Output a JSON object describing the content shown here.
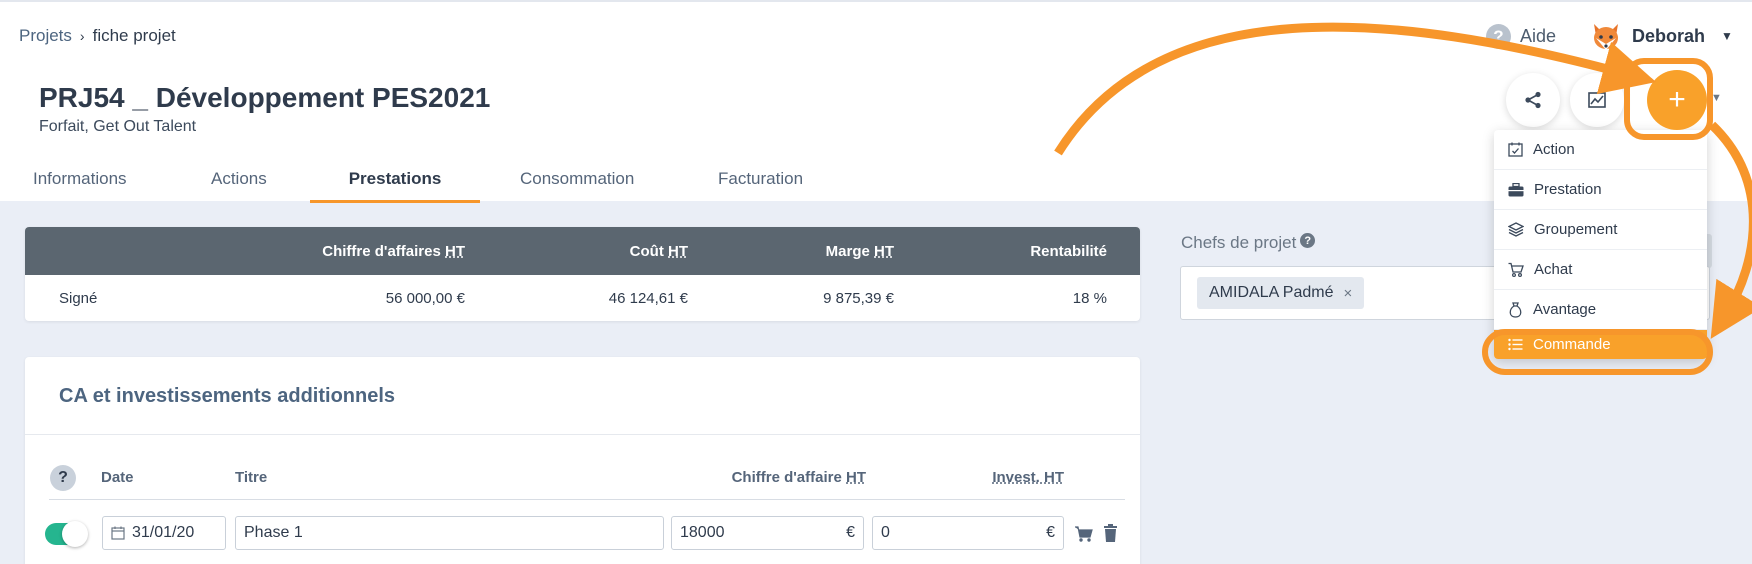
{
  "breadcrumb": {
    "parent": "Projets",
    "separator": "›",
    "current": "fiche projet"
  },
  "header": {
    "help_label": "Aide",
    "user_name": "Deborah",
    "project_title": "PRJ54 _ Développement PES2021",
    "project_subtitle": "Forfait, Get Out Talent"
  },
  "actions": {
    "plus_label": "+"
  },
  "tabs": [
    {
      "label": "Informations"
    },
    {
      "label": "Actions"
    },
    {
      "label": "Prestations"
    },
    {
      "label": "Consommation"
    },
    {
      "label": "Facturation"
    }
  ],
  "summary": {
    "headers": {
      "ca_prefix": "Chiffre d'affaires ",
      "cout_prefix": "Coût ",
      "marge_prefix": "Marge ",
      "ht": "HT",
      "rentabilite": "Rentabilité"
    },
    "row": {
      "label": "Signé",
      "ca": "56 000,00 €",
      "cout": "46 124,61 €",
      "marge": "9 875,39 €",
      "rentabilite": "18 %"
    }
  },
  "ca_section": {
    "title": "CA et investissements additionnels",
    "columns": {
      "help": "?",
      "date": "Date",
      "titre": "Titre",
      "ca_prefix": "Chiffre d'affaire ",
      "invest_prefix": "Invest. ",
      "ht": "HT"
    },
    "row": {
      "date": "31/01/20",
      "titre": "Phase 1",
      "ca": "18000",
      "ca_unit": "€",
      "invest": "0",
      "invest_unit": "€"
    }
  },
  "chefs": {
    "label": "Chefs de projet",
    "help": "?",
    "chip": "AMIDALA Padmé",
    "chip_remove": "×"
  },
  "menu": {
    "items": [
      {
        "label": "Action",
        "icon": "calendar-check-icon"
      },
      {
        "label": "Prestation",
        "icon": "briefcase-icon"
      },
      {
        "label": "Groupement",
        "icon": "layers-icon"
      },
      {
        "label": "Achat",
        "icon": "cart-icon"
      },
      {
        "label": "Avantage",
        "icon": "money-bag-icon"
      },
      {
        "label": "Commande",
        "icon": "list-icon"
      }
    ]
  },
  "colors": {
    "accent": "#f7962b",
    "table_header": "#5b6670",
    "toggle_on": "#25b58f",
    "background": "#eaeef6"
  }
}
